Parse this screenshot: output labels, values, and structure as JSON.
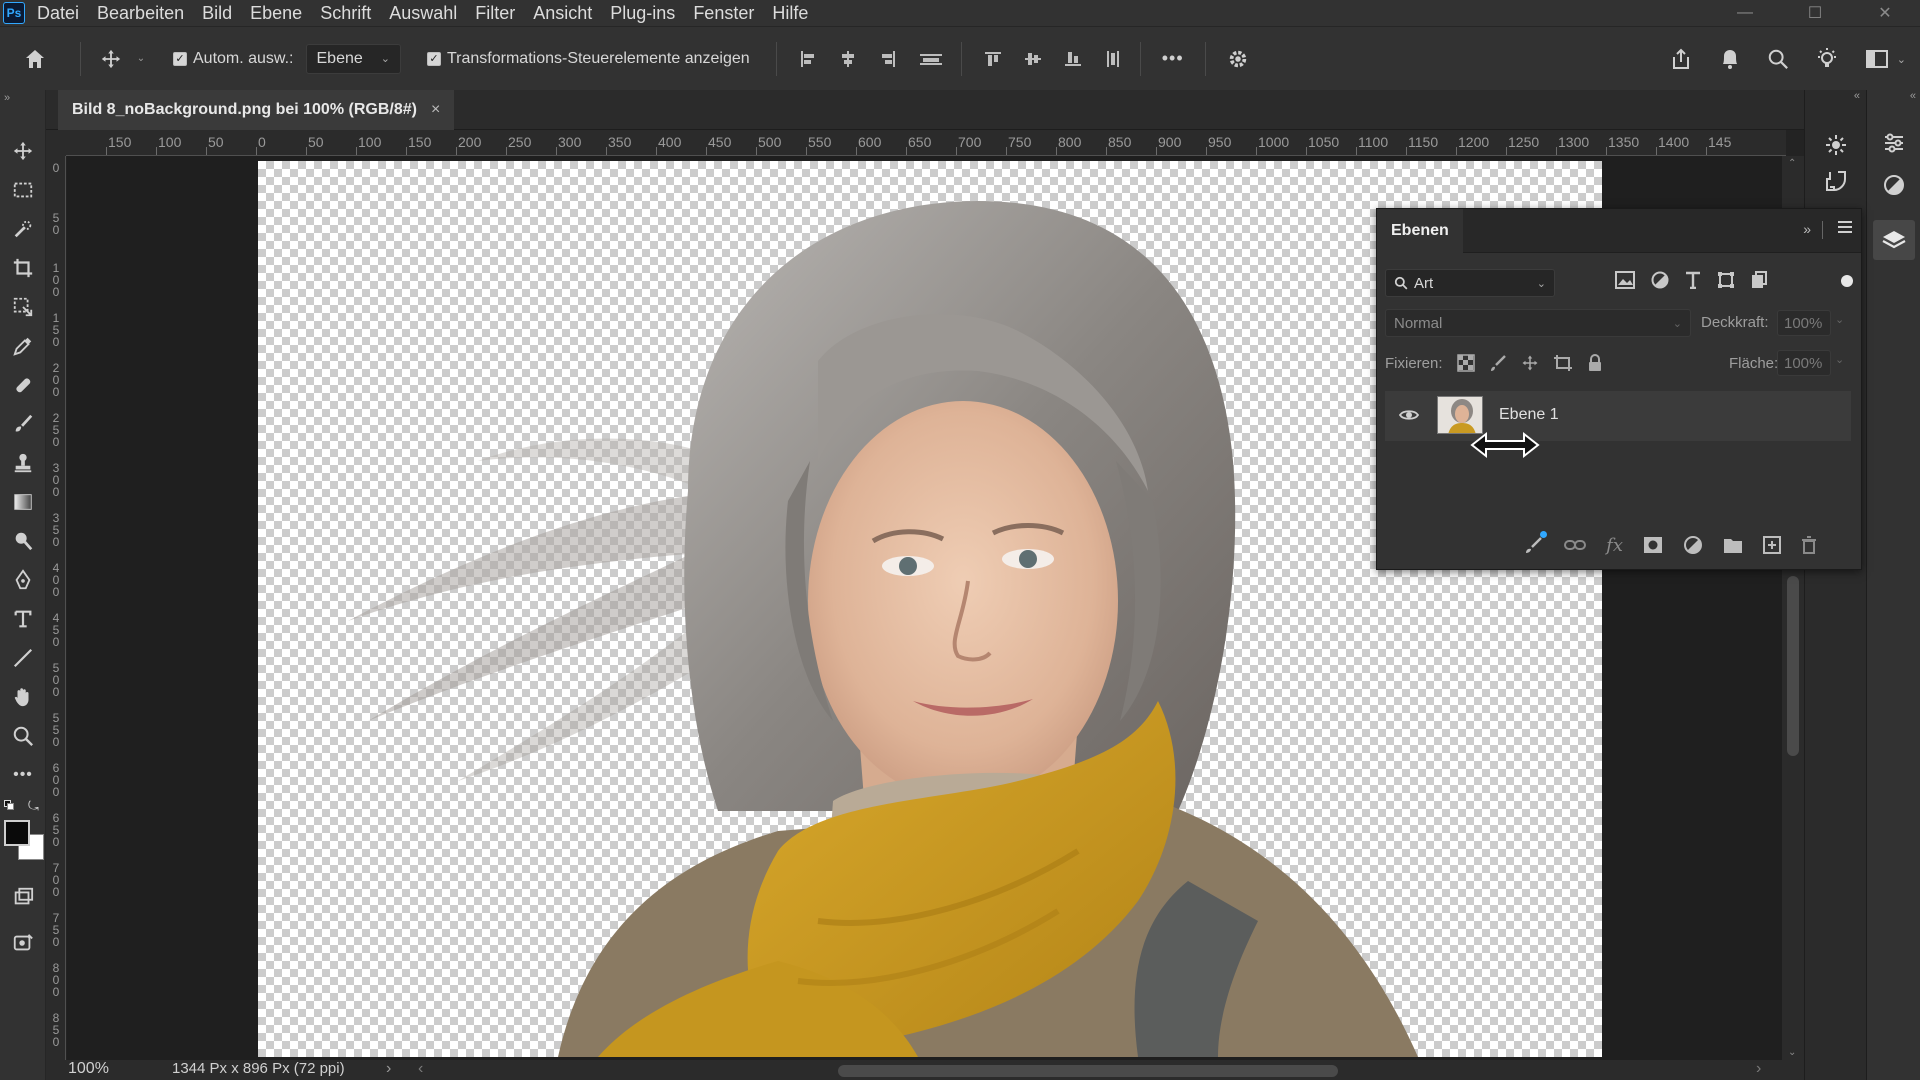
{
  "app": {
    "logo": "Ps"
  },
  "menu": [
    "Datei",
    "Bearbeiten",
    "Bild",
    "Ebene",
    "Schrift",
    "Auswahl",
    "Filter",
    "Ansicht",
    "Plug-ins",
    "Fenster",
    "Hilfe"
  ],
  "options": {
    "auto_select_label": "Autom. ausw.:",
    "auto_select_target": "Ebene",
    "transform_label": "Transformations-Steuerelemente anzeigen",
    "more": "•••"
  },
  "document": {
    "tab_title": "Bild 8_noBackground.png bei 100% (RGB/8#)",
    "close": "×"
  },
  "ruler": {
    "h_labels": [
      "150",
      "100",
      "50",
      "0",
      "50",
      "100",
      "150",
      "200",
      "250",
      "300",
      "350",
      "400",
      "450",
      "500",
      "550",
      "600",
      "650",
      "700",
      "750",
      "800",
      "850",
      "900",
      "950",
      "1000",
      "1050",
      "1100",
      "1150",
      "1200",
      "1250",
      "1300",
      "1350",
      "1400",
      "145"
    ],
    "v_labels": [
      "0",
      "5\n0",
      "1\n0\n0",
      "1\n5\n0",
      "2\n0\n0",
      "2\n5\n0",
      "3\n0\n0",
      "3\n5\n0",
      "4\n0\n0",
      "4\n5\n0",
      "5\n0\n0",
      "5\n5\n0",
      "6\n0\n0",
      "6\n5\n0",
      "7\n0\n0",
      "7\n5\n0",
      "8\n0\n0",
      "8\n5\n0"
    ]
  },
  "status": {
    "zoom": "100%",
    "doc_size": "1344 Px x 896 Px (72 ppi)",
    "arrow": "›",
    "scroll_left": "‹",
    "scroll_right": "›"
  },
  "layers_panel": {
    "title": "Ebenen",
    "filter_kind": "Art",
    "blend_mode": "Normal",
    "opacity_label": "Deckkraft:",
    "opacity_value": "100%",
    "lock_label": "Fixieren:",
    "fill_label": "Fläche:",
    "fill_value": "100%",
    "layers": [
      {
        "name": "Ebene 1",
        "visible": true
      }
    ],
    "footer_icons": [
      "brush-link-icon",
      "link-icon",
      "fx-icon",
      "mask-icon",
      "adjustment-icon",
      "folder-icon",
      "new-layer-icon",
      "trash-icon"
    ],
    "fx_text": "fx"
  },
  "colors": {
    "accent": "#31a8ff",
    "scarf": "#c99a22",
    "jacket": "#8a7a62",
    "hair": "#8d8a87",
    "skin": "#e6c2a8"
  }
}
